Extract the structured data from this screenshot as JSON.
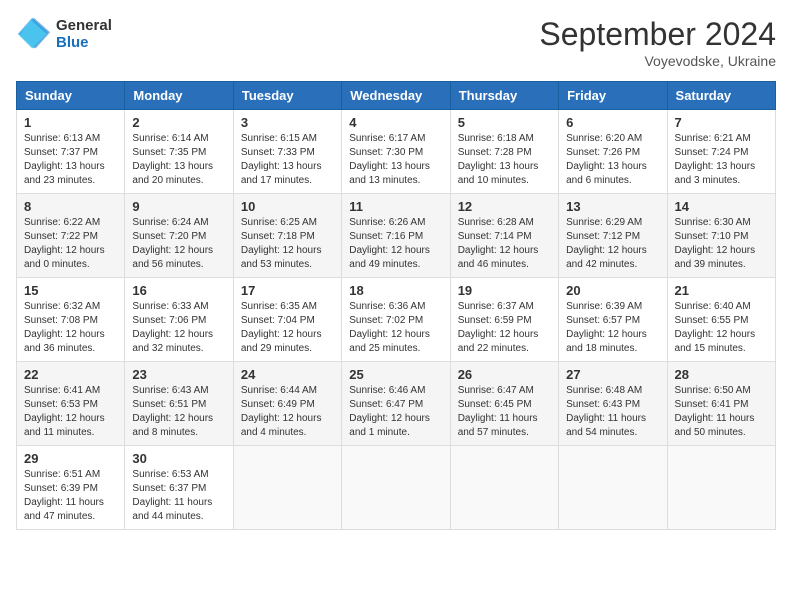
{
  "header": {
    "logo_line1": "General",
    "logo_line2": "Blue",
    "month": "September 2024",
    "location": "Voyevodske, Ukraine"
  },
  "days_of_week": [
    "Sunday",
    "Monday",
    "Tuesday",
    "Wednesday",
    "Thursday",
    "Friday",
    "Saturday"
  ],
  "weeks": [
    [
      {
        "day": "1",
        "sunrise": "6:13 AM",
        "sunset": "7:37 PM",
        "daylight": "13 hours and 23 minutes."
      },
      {
        "day": "2",
        "sunrise": "6:14 AM",
        "sunset": "7:35 PM",
        "daylight": "13 hours and 20 minutes."
      },
      {
        "day": "3",
        "sunrise": "6:15 AM",
        "sunset": "7:33 PM",
        "daylight": "13 hours and 17 minutes."
      },
      {
        "day": "4",
        "sunrise": "6:17 AM",
        "sunset": "7:30 PM",
        "daylight": "13 hours and 13 minutes."
      },
      {
        "day": "5",
        "sunrise": "6:18 AM",
        "sunset": "7:28 PM",
        "daylight": "13 hours and 10 minutes."
      },
      {
        "day": "6",
        "sunrise": "6:20 AM",
        "sunset": "7:26 PM",
        "daylight": "13 hours and 6 minutes."
      },
      {
        "day": "7",
        "sunrise": "6:21 AM",
        "sunset": "7:24 PM",
        "daylight": "13 hours and 3 minutes."
      }
    ],
    [
      {
        "day": "8",
        "sunrise": "6:22 AM",
        "sunset": "7:22 PM",
        "daylight": "12 hours and 0 minutes."
      },
      {
        "day": "9",
        "sunrise": "6:24 AM",
        "sunset": "7:20 PM",
        "daylight": "12 hours and 56 minutes."
      },
      {
        "day": "10",
        "sunrise": "6:25 AM",
        "sunset": "7:18 PM",
        "daylight": "12 hours and 53 minutes."
      },
      {
        "day": "11",
        "sunrise": "6:26 AM",
        "sunset": "7:16 PM",
        "daylight": "12 hours and 49 minutes."
      },
      {
        "day": "12",
        "sunrise": "6:28 AM",
        "sunset": "7:14 PM",
        "daylight": "12 hours and 46 minutes."
      },
      {
        "day": "13",
        "sunrise": "6:29 AM",
        "sunset": "7:12 PM",
        "daylight": "12 hours and 42 minutes."
      },
      {
        "day": "14",
        "sunrise": "6:30 AM",
        "sunset": "7:10 PM",
        "daylight": "12 hours and 39 minutes."
      }
    ],
    [
      {
        "day": "15",
        "sunrise": "6:32 AM",
        "sunset": "7:08 PM",
        "daylight": "12 hours and 36 minutes."
      },
      {
        "day": "16",
        "sunrise": "6:33 AM",
        "sunset": "7:06 PM",
        "daylight": "12 hours and 32 minutes."
      },
      {
        "day": "17",
        "sunrise": "6:35 AM",
        "sunset": "7:04 PM",
        "daylight": "12 hours and 29 minutes."
      },
      {
        "day": "18",
        "sunrise": "6:36 AM",
        "sunset": "7:02 PM",
        "daylight": "12 hours and 25 minutes."
      },
      {
        "day": "19",
        "sunrise": "6:37 AM",
        "sunset": "6:59 PM",
        "daylight": "12 hours and 22 minutes."
      },
      {
        "day": "20",
        "sunrise": "6:39 AM",
        "sunset": "6:57 PM",
        "daylight": "12 hours and 18 minutes."
      },
      {
        "day": "21",
        "sunrise": "6:40 AM",
        "sunset": "6:55 PM",
        "daylight": "12 hours and 15 minutes."
      }
    ],
    [
      {
        "day": "22",
        "sunrise": "6:41 AM",
        "sunset": "6:53 PM",
        "daylight": "12 hours and 11 minutes."
      },
      {
        "day": "23",
        "sunrise": "6:43 AM",
        "sunset": "6:51 PM",
        "daylight": "12 hours and 8 minutes."
      },
      {
        "day": "24",
        "sunrise": "6:44 AM",
        "sunset": "6:49 PM",
        "daylight": "12 hours and 4 minutes."
      },
      {
        "day": "25",
        "sunrise": "6:46 AM",
        "sunset": "6:47 PM",
        "daylight": "12 hours and 1 minute."
      },
      {
        "day": "26",
        "sunrise": "6:47 AM",
        "sunset": "6:45 PM",
        "daylight": "11 hours and 57 minutes."
      },
      {
        "day": "27",
        "sunrise": "6:48 AM",
        "sunset": "6:43 PM",
        "daylight": "11 hours and 54 minutes."
      },
      {
        "day": "28",
        "sunrise": "6:50 AM",
        "sunset": "6:41 PM",
        "daylight": "11 hours and 50 minutes."
      }
    ],
    [
      {
        "day": "29",
        "sunrise": "6:51 AM",
        "sunset": "6:39 PM",
        "daylight": "11 hours and 47 minutes."
      },
      {
        "day": "30",
        "sunrise": "6:53 AM",
        "sunset": "6:37 PM",
        "daylight": "11 hours and 44 minutes."
      },
      null,
      null,
      null,
      null,
      null
    ]
  ]
}
